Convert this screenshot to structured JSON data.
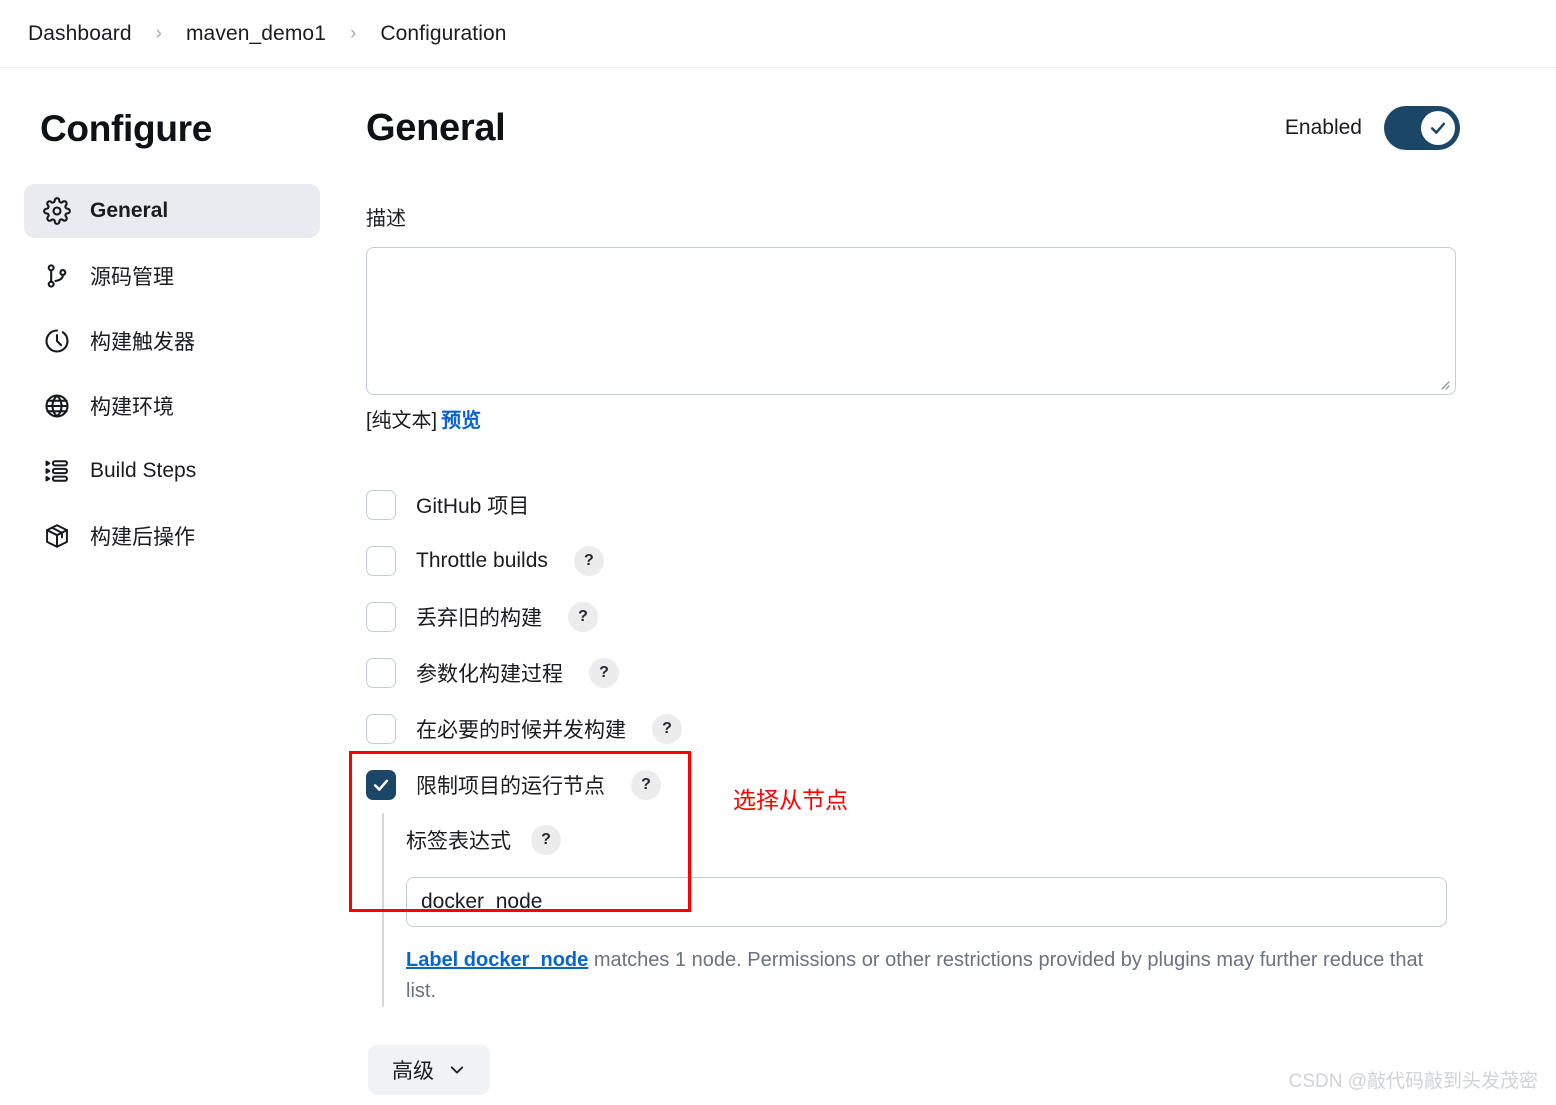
{
  "breadcrumb": {
    "items": [
      {
        "label": "Dashboard"
      },
      {
        "label": "maven_demo1"
      },
      {
        "label": "Configuration"
      }
    ],
    "separator": "›"
  },
  "sidebar": {
    "title": "Configure",
    "items": [
      {
        "label": "General",
        "icon": "gear-icon",
        "active": true
      },
      {
        "label": "源码管理",
        "icon": "git-branch-icon",
        "active": false
      },
      {
        "label": "构建触发器",
        "icon": "clock-icon",
        "active": false
      },
      {
        "label": "构建环境",
        "icon": "globe-icon",
        "active": false
      },
      {
        "label": "Build Steps",
        "icon": "list-steps-icon",
        "active": false
      },
      {
        "label": "构建后操作",
        "icon": "package-icon",
        "active": false
      }
    ]
  },
  "main": {
    "title": "General",
    "enabled_label": "Enabled",
    "enabled_state": true,
    "description": {
      "label": "描述",
      "value": "",
      "placeholder": "",
      "plain_text_marker": "[纯文本]",
      "preview_link": "预览"
    },
    "checkboxes": [
      {
        "label": "GitHub 项目",
        "checked": false,
        "help": false
      },
      {
        "label": "Throttle builds",
        "checked": false,
        "help": true
      },
      {
        "label": "丢弃旧的构建",
        "checked": false,
        "help": true
      },
      {
        "label": "参数化构建过程",
        "checked": false,
        "help": true
      },
      {
        "label": "在必要的时候并发构建",
        "checked": false,
        "help": true
      }
    ],
    "restrict": {
      "label": "限制项目的运行节点",
      "checked": true,
      "help": true,
      "sub_label": "标签表达式",
      "sub_help": true,
      "input_value": "docker_node",
      "input_placeholder": "",
      "match_link": "Label docker_node",
      "match_text": " matches 1 node. Permissions or other restrictions provided by plugins may further reduce that list."
    },
    "annotation": {
      "text": "选择从节点",
      "color": "#fe0000"
    },
    "advanced_button": {
      "label": "高级",
      "icon": "chevron-down-icon"
    }
  },
  "watermark": {
    "text": "CSDN @敲代码敲到头发茂密"
  },
  "help_badge_glyph": "?",
  "colors": {
    "accent": "#1b4667",
    "link": "#0b63ce",
    "annotation": "#fe0000",
    "border": "#c3cdd7",
    "active_nav_bg": "#e9ebf0"
  }
}
